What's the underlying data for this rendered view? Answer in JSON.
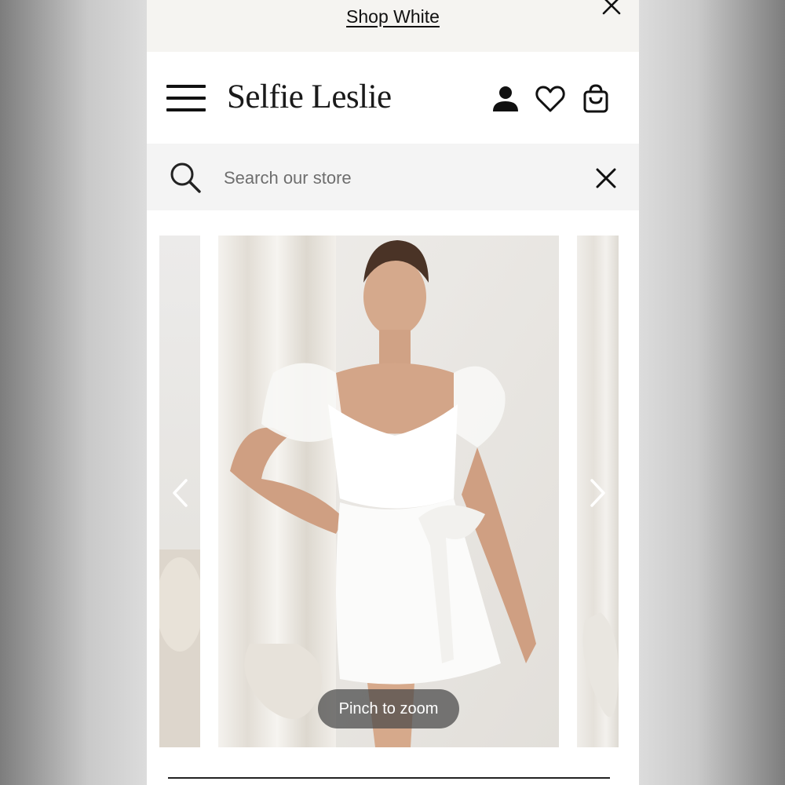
{
  "announcement": {
    "link_text": "Shop White"
  },
  "header": {
    "logo": "Selfie Leslie",
    "icons": [
      "menu-icon",
      "account-icon",
      "wishlist-heart-icon",
      "cart-bag-icon"
    ]
  },
  "search": {
    "placeholder": "Search our store",
    "value": ""
  },
  "gallery": {
    "zoom_hint": "Pinch to zoom",
    "image_description_semantic": "product-photo-white-lace-mini-dress"
  },
  "colors": {
    "announcement_bg": "#f5f4f1",
    "search_bg": "#f4f4f4",
    "text": "#111111"
  }
}
